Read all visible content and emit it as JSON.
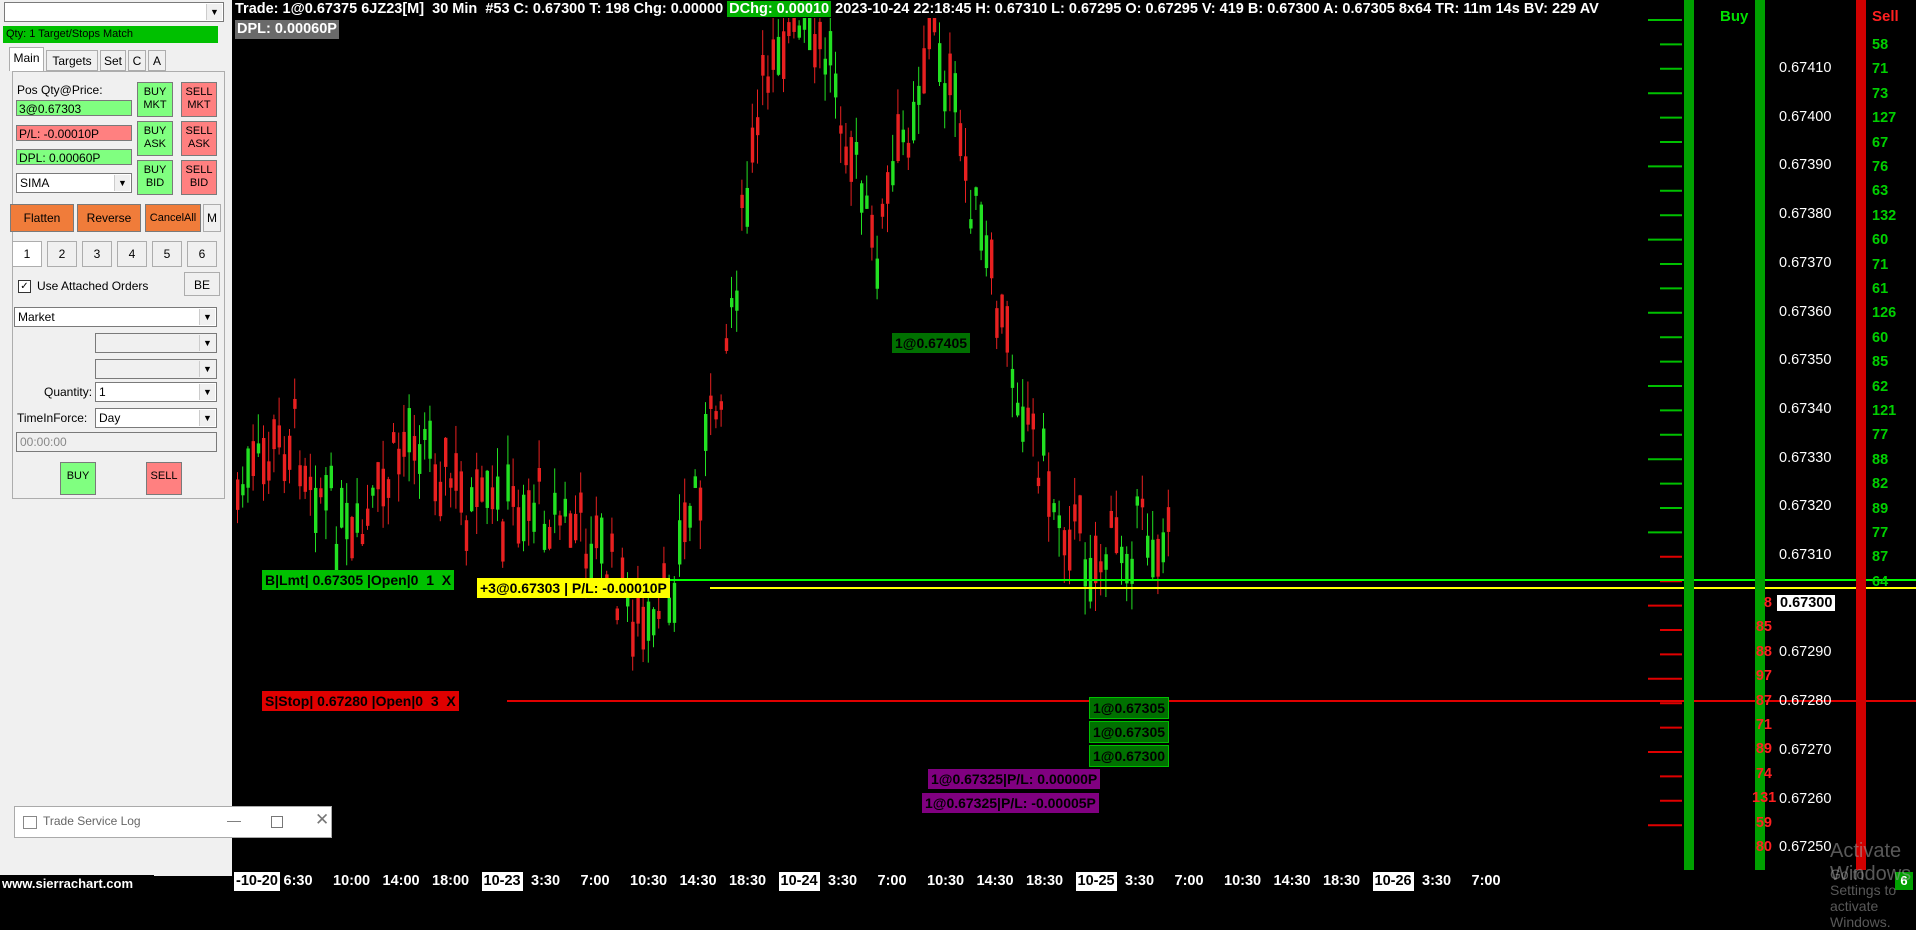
{
  "trade_window": {
    "qty_bar": "Qty: 1 Target/Stops Match",
    "tabs": [
      "Main",
      "Targets",
      "Set",
      "C",
      "A"
    ],
    "pos_label": "Pos Qty@Price:",
    "pos_value": "3@0.67303",
    "pl_value": "P/L: -0.00010P",
    "dpl_value": "DPL: 0.00060P",
    "account": "SIMA",
    "buy_mkt": [
      "BUY",
      "MKT"
    ],
    "sell_mkt": [
      "SELL",
      "MKT"
    ],
    "buy_ask": [
      "BUY",
      "ASK"
    ],
    "sell_ask": [
      "SELL",
      "ASK"
    ],
    "buy_bid": [
      "BUY",
      "BID"
    ],
    "sell_bid": [
      "SELL",
      "BID"
    ],
    "flatten": "Flatten",
    "reverse": "Reverse",
    "cancel_all": "CancelAll",
    "m": "M",
    "qty_presets": [
      "1",
      "2",
      "3",
      "4",
      "5",
      "6"
    ],
    "use_attached": "Use Attached Orders",
    "be": "BE",
    "order_type": "Market",
    "quantity_label": "Quantity:",
    "quantity_value": "1",
    "tif_label": "TimeInForce:",
    "tif_value": "Day",
    "time_value": "00:00:00",
    "buy": "BUY",
    "sell": "SELL",
    "site": "www.sierrachart.com"
  },
  "trade_log": {
    "title": "Trade Service Log"
  },
  "header": {
    "trade": "Trade: 1@0.67375",
    "symbol": "6JZ23[M]",
    "period": "30 Min",
    "bar": "#53",
    "close": "C: 0.67300",
    "ticks": "T: 198",
    "chg": "Chg: 0.00000",
    "dchg": "DChg: 0.00010",
    "rest": "2023-10-24 22:18:45 H: 0.67310 L: 0.67295 O: 0.67295 V: 419 B: 0.67300 A: 0.67305 8x64 TR: 11m 14s BV: 229 AV",
    "dpl": "DPL: 0.00060P"
  },
  "chart_tags": {
    "buy_order": [
      "B|Lmt| 0.67305 |Open|0",
      "1",
      "X"
    ],
    "position": "+3@0.67303 | P/L: -0.00010P",
    "stop_order": [
      "S|Stop| 0.67280 |Open|0",
      "3",
      "X"
    ],
    "fill_top": "1@0.67405",
    "fills_right": [
      "1@0.67305",
      "1@0.67305",
      "1@0.67300"
    ],
    "fills_purple": [
      "1@0.67325|P/L: 0.00000P",
      "1@0.67325|P/L: -0.00005P"
    ]
  },
  "dom": {
    "buy_label": "Buy",
    "sell_label": "Sell",
    "price_labels": [
      "0.67410",
      "0.67400",
      "0.67390",
      "0.67380",
      "0.67370",
      "0.67360",
      "0.67350",
      "0.67340",
      "0.67330",
      "0.67320",
      "0.67310",
      "0.67300",
      "0.67290",
      "0.67280",
      "0.67270",
      "0.67260",
      "0.67250"
    ],
    "current_price": "0.67300",
    "ask_volumes": [
      "58",
      "71",
      "73",
      "127",
      "67",
      "76",
      "63",
      "132",
      "60",
      "71",
      "61",
      "126",
      "60",
      "85",
      "62",
      "121",
      "77",
      "88",
      "82",
      "89",
      "77",
      "87",
      "64"
    ],
    "bid_volumes": [
      "8",
      "85",
      "88",
      "97",
      "87",
      "71",
      "89",
      "74",
      "131",
      "59",
      "80"
    ],
    "corner_count": "6"
  },
  "x_labels": [
    {
      "t": "-10-20",
      "box": true
    },
    {
      "t": "6:30"
    },
    {
      "t": "10:00"
    },
    {
      "t": "14:00"
    },
    {
      "t": "18:00"
    },
    {
      "t": "10-23",
      "box": true
    },
    {
      "t": "3:30"
    },
    {
      "t": "7:00"
    },
    {
      "t": "10:30"
    },
    {
      "t": "14:30"
    },
    {
      "t": "18:30"
    },
    {
      "t": "10-24",
      "box": true
    },
    {
      "t": "3:30"
    },
    {
      "t": "7:00"
    },
    {
      "t": "10:30"
    },
    {
      "t": "14:30"
    },
    {
      "t": "18:30"
    },
    {
      "t": "10-25",
      "box": true
    },
    {
      "t": "3:30"
    },
    {
      "t": "7:00"
    },
    {
      "t": "10:30"
    },
    {
      "t": "14:30"
    },
    {
      "t": "18:30"
    },
    {
      "t": "10-26",
      "box": true
    },
    {
      "t": "3:30"
    },
    {
      "t": "7:00"
    }
  ],
  "watermark": [
    "Activate Windows",
    "Go to Settings to activate Windows."
  ],
  "colors": {
    "up": "#22e022",
    "down": "#e82020",
    "buy": "#00b000",
    "sell": "#d00000",
    "position": "#ffff00",
    "fill_purple": "#800080"
  }
}
